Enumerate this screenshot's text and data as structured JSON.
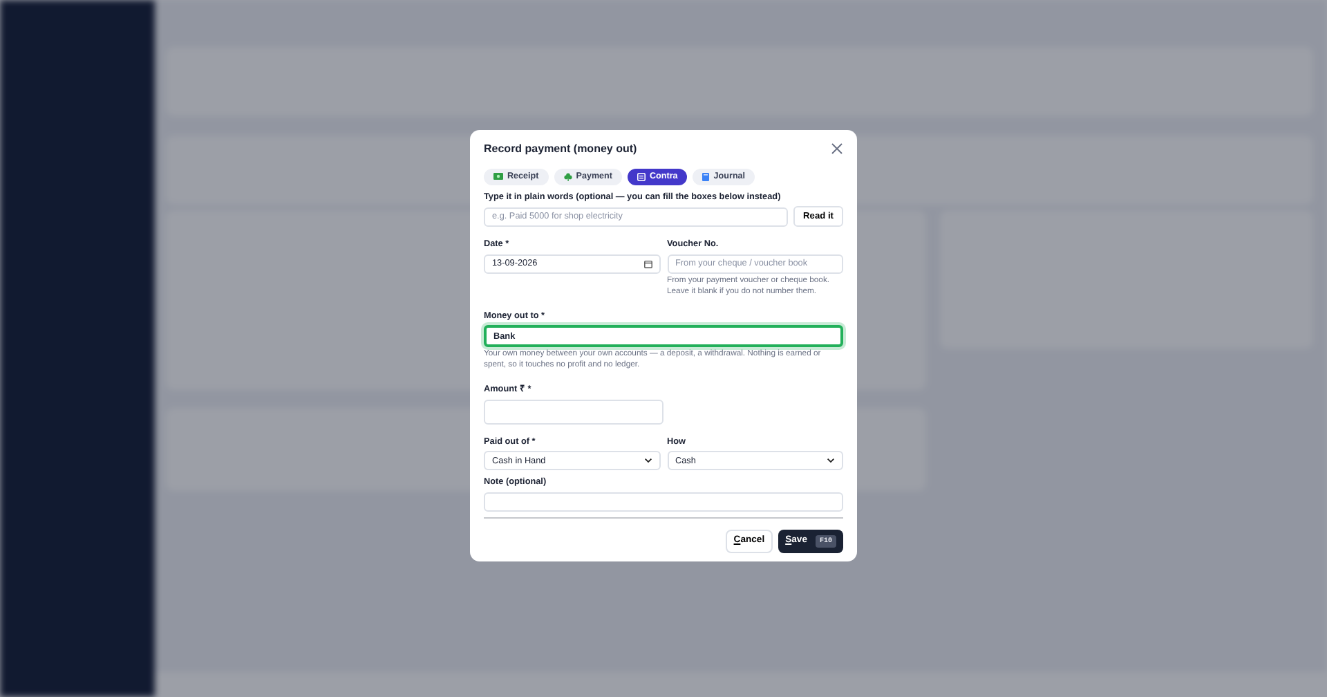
{
  "dialog": {
    "title": "Record payment (money out)",
    "tabs": [
      {
        "label": "Receipt",
        "kind": "receipt",
        "selected": false
      },
      {
        "label": "Payment",
        "kind": "payment",
        "selected": false
      },
      {
        "label": "Contra",
        "kind": "contra",
        "selected": true
      },
      {
        "label": "Journal",
        "kind": "journal",
        "selected": false
      }
    ],
    "quick_entry": {
      "label": "Type it in plain words (optional — you can fill the boxes below instead)",
      "placeholder": "e.g. Paid 5000 for shop electricity",
      "button": "Read it"
    },
    "date": {
      "label": "Date *",
      "value": "13-09-2026"
    },
    "voucher_no": {
      "label": "Voucher No.",
      "placeholder": "From your cheque / voucher book",
      "help": "From your payment voucher or cheque book. Leave it blank if you do not number them."
    },
    "money_out_to": {
      "label": "Money out to *",
      "value": "Bank",
      "focused": true,
      "help": "Your own money between your own accounts — a deposit, a withdrawal. Nothing is earned or spent, so it touches no profit and no ledger."
    },
    "amount": {
      "label": "Amount ₹ *"
    },
    "paid_out_of": {
      "label": "Paid out of *",
      "value": "Cash in Hand"
    },
    "how": {
      "label": "How",
      "value": "Cash"
    },
    "note": {
      "label": "Note (optional)"
    },
    "buttons": {
      "cancel": "Cancel",
      "save": "Save",
      "save_shortcut": "F10"
    }
  }
}
